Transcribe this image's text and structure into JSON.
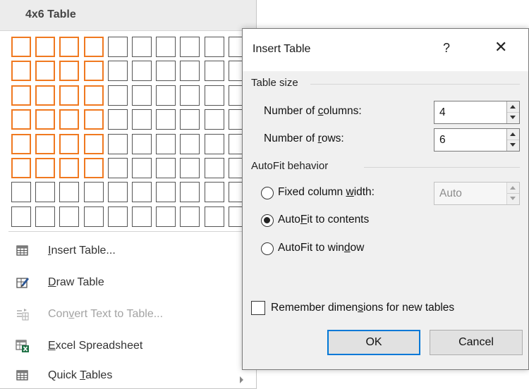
{
  "menu": {
    "grid_title": "4x6 Table",
    "grid": {
      "columns": 10,
      "rows": 8,
      "selected_columns": 4,
      "selected_rows": 6
    },
    "items": [
      {
        "label": "Insert Table...",
        "icon": "insert-table-icon",
        "disabled": false
      },
      {
        "label": "Draw Table",
        "icon": "draw-table-icon",
        "disabled": false
      },
      {
        "label": "Convert Text to Table...",
        "icon": "convert-text-icon",
        "disabled": true
      },
      {
        "label": "Excel Spreadsheet",
        "icon": "excel-spreadsheet-icon",
        "disabled": false
      },
      {
        "label": "Quick Tables",
        "icon": "quick-tables-icon",
        "disabled": false,
        "submenu": true
      }
    ]
  },
  "dialog": {
    "title": "Insert Table",
    "help": "?",
    "close": "✕",
    "table_size": {
      "heading": "Table size",
      "columns_label": "Number of columns:",
      "columns_value": "4",
      "rows_label": "Number of rows:",
      "rows_value": "6"
    },
    "autofit": {
      "heading": "AutoFit behavior",
      "fixed_label": "Fixed column width:",
      "fixed_value": "Auto",
      "contents_label": "AutoFit to contents",
      "window_label": "AutoFit to window",
      "selected": "contents"
    },
    "remember_label": "Remember dimensions for new tables",
    "remember_checked": false,
    "ok_label": "OK",
    "cancel_label": "Cancel"
  },
  "colors": {
    "selection": "#f07920",
    "focus": "#0078d7",
    "dialog_body": "#f0f0f0"
  }
}
